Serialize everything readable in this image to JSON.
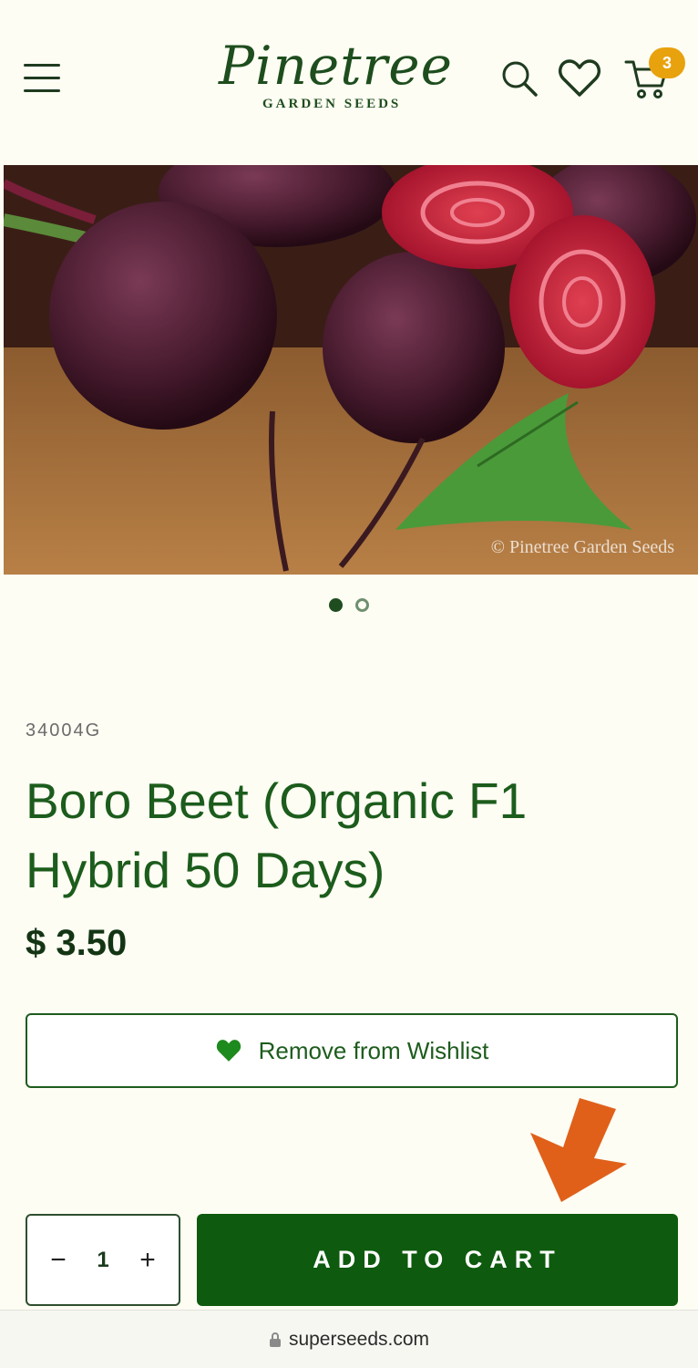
{
  "brand": {
    "logo_script": "Pinetree",
    "logo_subtitle": "GARDEN SEEDS",
    "logo_color": "#1e4d1e"
  },
  "header": {
    "menu_icon": "hamburger-menu-icon",
    "search_icon": "search-icon",
    "wishlist_icon": "heart-icon",
    "cart_icon": "cart-icon",
    "cart_count": "3",
    "badge_color": "#e8a20e"
  },
  "gallery": {
    "watermark": "© Pinetree Garden Seeds",
    "slide_count": 2,
    "active_slide": 1
  },
  "product": {
    "sku": "34004G",
    "title": "Boro Beet (Organic F1 Hybrid 50 Days)",
    "price": "$ 3.50"
  },
  "wishlist": {
    "label": "Remove from Wishlist",
    "icon": "heart-filled-icon"
  },
  "purchase": {
    "decrement": "−",
    "quantity": "1",
    "increment": "+",
    "add_to_cart": "ADD TO CART",
    "button_color": "#0e5a0e"
  },
  "annotation": {
    "arrow_color": "#e0601a",
    "arrow_icon": "arrow-down-left-icon"
  },
  "browser": {
    "lock_icon": "lock-icon",
    "url": "superseeds.com"
  }
}
